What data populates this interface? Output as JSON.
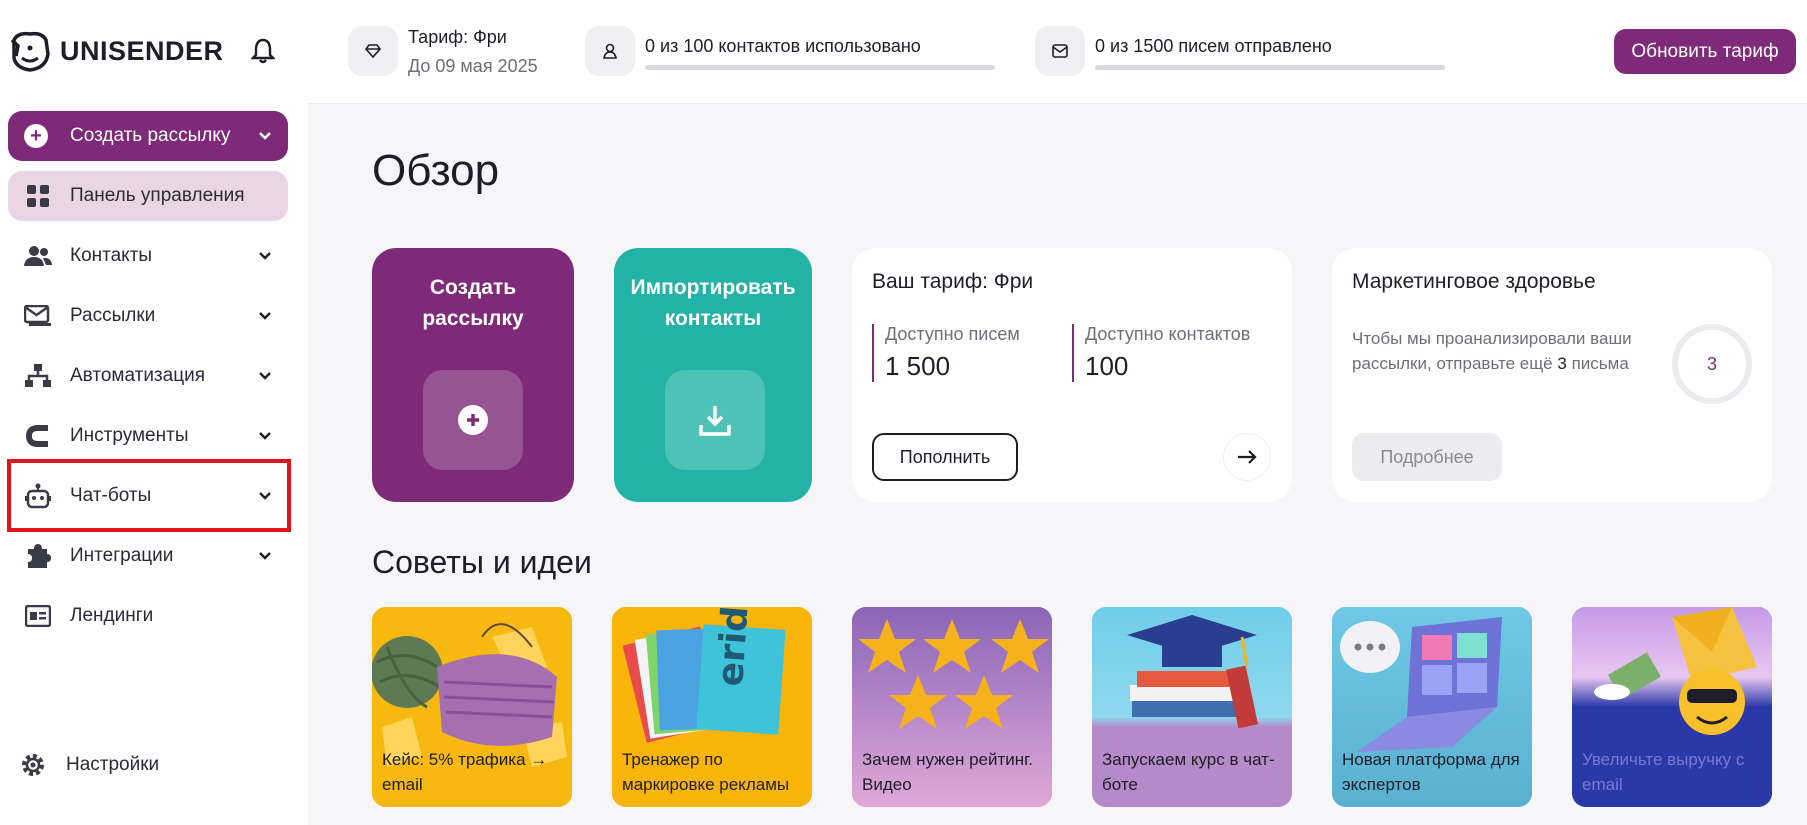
{
  "app": {
    "logo_text": "UNISENDER"
  },
  "topbar": {
    "tariff_title": "Тариф: Фри",
    "tariff_until": "До 09 мая 2025",
    "contacts_usage": "0 из 100 контактов использовано",
    "contacts_progress": 0,
    "emails_usage": "0 из 1500 писем отправлено",
    "emails_progress": 0,
    "upgrade_label": "Обновить тариф"
  },
  "sidebar": {
    "create_label": "Создать рассылку",
    "items": [
      {
        "label": "Панель управления",
        "icon": "dashboard-icon",
        "active": true,
        "has_chevron": false
      },
      {
        "label": "Контакты",
        "icon": "users-icon",
        "active": false,
        "has_chevron": true
      },
      {
        "label": "Рассылки",
        "icon": "mail-icon",
        "active": false,
        "has_chevron": true
      },
      {
        "label": "Автоматизация",
        "icon": "sitemap-icon",
        "active": false,
        "has_chevron": true
      },
      {
        "label": "Инструменты",
        "icon": "magnet-icon",
        "active": false,
        "has_chevron": true
      },
      {
        "label": "Чат-боты",
        "icon": "robot-icon",
        "active": false,
        "has_chevron": true
      },
      {
        "label": "Интеграции",
        "icon": "puzzle-icon",
        "active": false,
        "has_chevron": true
      },
      {
        "label": "Лендинги",
        "icon": "landing-page-icon",
        "active": false,
        "has_chevron": false
      }
    ],
    "settings_label": "Настройки"
  },
  "main": {
    "page_title": "Обзор",
    "card_create_label": "Создать рассылку",
    "card_import_label": "Импортировать контакты",
    "tariff_card": {
      "title": "Ваш тариф: Фри",
      "emails_label": "Доступно писем",
      "emails_value": "1 500",
      "contacts_label": "Доступно контактов",
      "contacts_value": "100",
      "topup_label": "Пополнить"
    },
    "health_card": {
      "title": "Маркетинговое здоровье",
      "text_before": "Чтобы мы проанализировали ваши рассылки, отправьте ещё",
      "text_num": "3",
      "text_after": "письма",
      "ring_value": "3",
      "more_label": "Подробнее"
    },
    "tips_title": "Советы и идеи",
    "tips": [
      {
        "caption": "Кейс: 5% трафика → email"
      },
      {
        "caption": "Тренажер по маркировке рекламы"
      },
      {
        "caption": "Зачем нужен рейтинг. Видео"
      },
      {
        "caption": "Запускаем курс в чат-боте"
      },
      {
        "caption": "Новая платформа для экспертов"
      },
      {
        "caption": "Увеличьте выручку с email"
      }
    ]
  },
  "colors": {
    "brand": "#7e2a79",
    "teal": "#22b3a6",
    "highlight": "#e0131b"
  }
}
